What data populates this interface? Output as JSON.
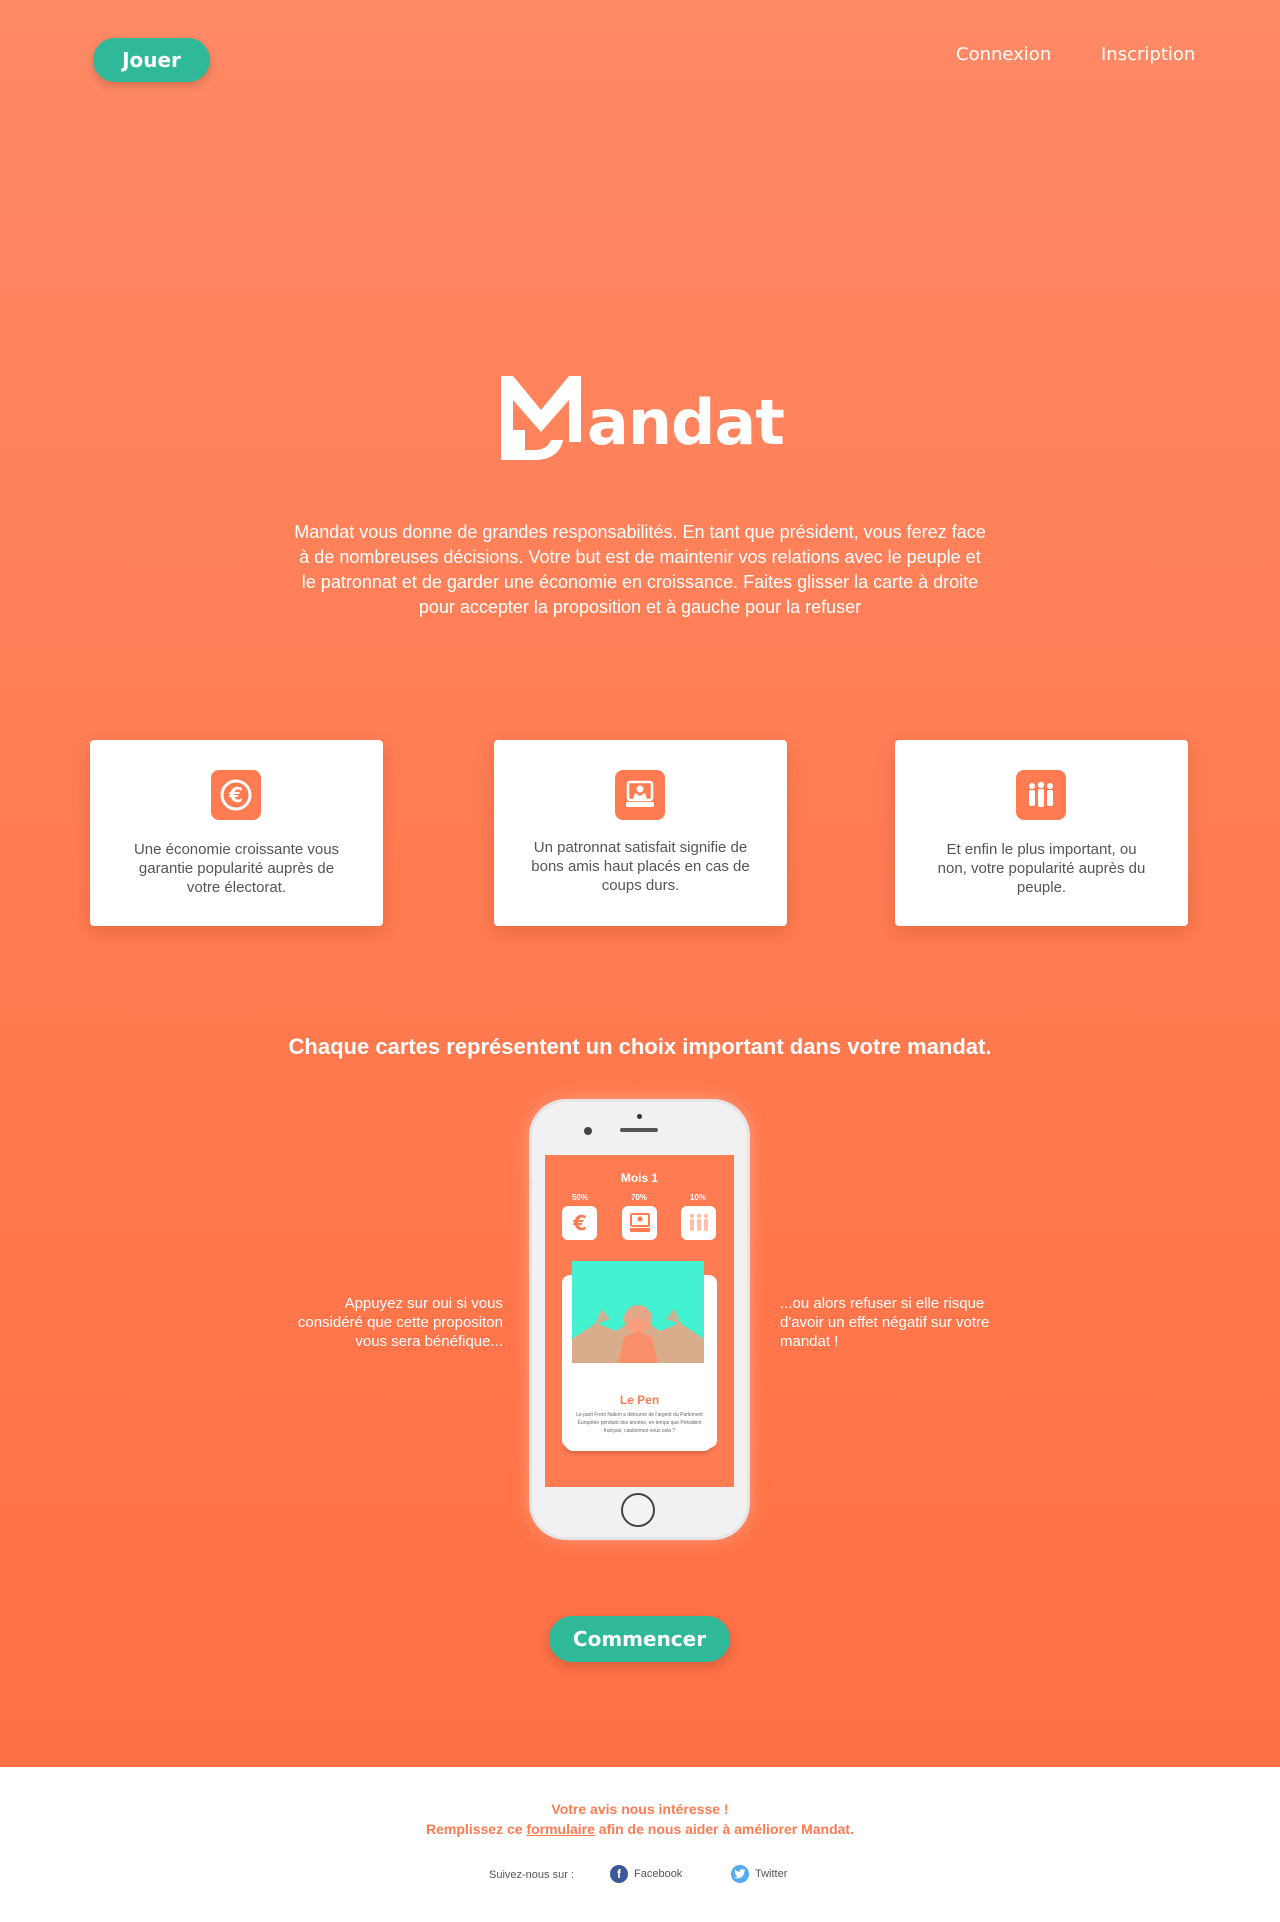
{
  "nav": {
    "play_label": "Jouer",
    "login_label": "Connexion",
    "signup_label": "Inscription"
  },
  "logo": {
    "text": "andat"
  },
  "intro": "Mandat vous donne de grandes responsabilités. En tant que président, vous ferez face à de nombreuses décisions. Votre but est de maintenir vos relations avec le peuple et le patronnat et de garder une économie en croissance. Faites glisser la carte à droite pour accepter la proposition et à gauche pour la refuser",
  "cards": [
    {
      "icon": "euro-icon",
      "text": "Une économie croissante vous garantie popularité auprès de votre électorat."
    },
    {
      "icon": "boss-icon",
      "text": "Un patronnat satisfait signifie de bons amis haut placés en cas de coups durs."
    },
    {
      "icon": "people-icon",
      "text": "Et enfin le plus important, ou non, votre popularité auprès du peuple."
    }
  ],
  "subtitle": "Chaque cartes représentent un choix important dans votre mandat.",
  "phone": {
    "month": "Mois 1",
    "stats": [
      {
        "label": "50%",
        "icon": "euro-icon"
      },
      {
        "label": "70%",
        "icon": "boss-icon"
      },
      {
        "label": "10%",
        "icon": "people-icon"
      }
    ],
    "card": {
      "name": "Le Pen",
      "description": "Le parti Front Nation a détourné de l'argent du Parlement Européen pendant des années, en temps que Président français, cautionnez-vous cela ?"
    }
  },
  "notes": {
    "left": "Appuyez sur oui si vous considéré que cette propositon vous sera bénéfique...",
    "right": "...ou alors refuser si elle risque d'avoir un effet négatif sur votre mandat !"
  },
  "start_label": "Commencer",
  "footer": {
    "line1": "Votre avis nous intéresse !",
    "line2_before": "Remplissez ce",
    "line2_link": "formulaire",
    "line2_after": "afin de nous aider à améliorer Mandat.",
    "follow": "Suivez-nous sur :",
    "facebook": "Facebook",
    "twitter": "Twitter"
  },
  "colors": {
    "brand_orange": "#ff7b51",
    "accent_green": "#2fb999",
    "card_image_teal": "#42f2d0"
  }
}
